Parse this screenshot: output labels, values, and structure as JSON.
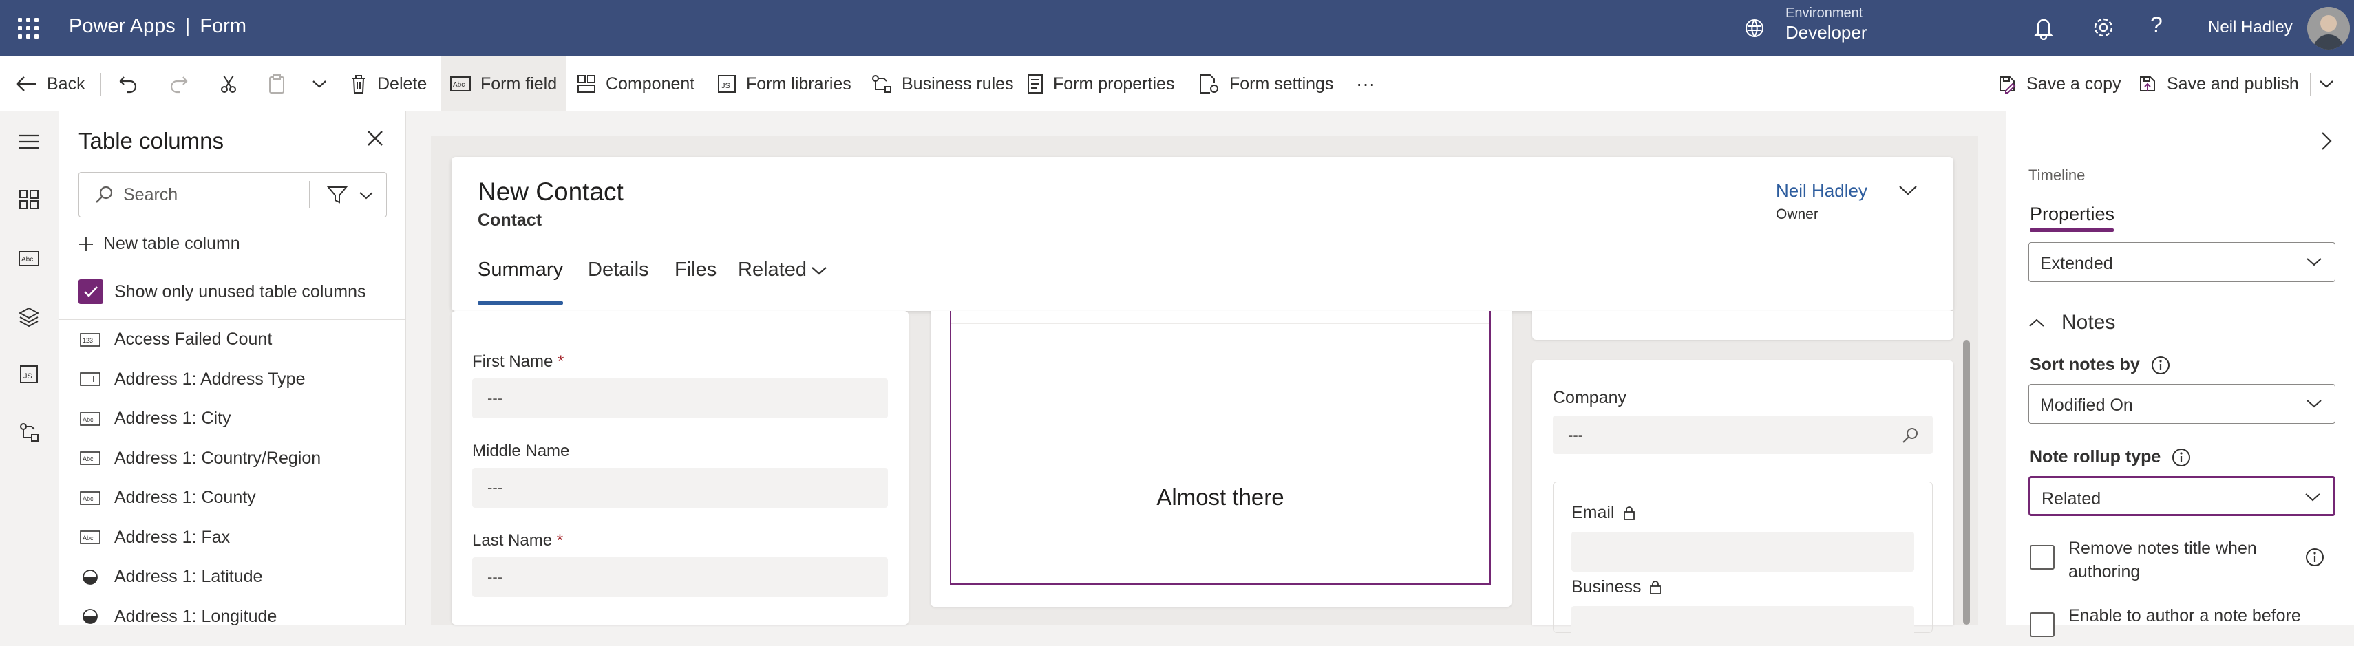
{
  "app": {
    "name": "Power Apps",
    "separator": "|",
    "page": "Form"
  },
  "environment": {
    "label": "Environment",
    "value": "Developer"
  },
  "user": {
    "name": "Neil Hadley"
  },
  "toolbar": {
    "back": "Back",
    "delete": "Delete",
    "form_field": "Form field",
    "component": "Component",
    "form_libraries": "Form libraries",
    "business_rules": "Business rules",
    "form_properties": "Form properties",
    "form_settings": "Form settings",
    "more": "···",
    "save_copy": "Save a copy",
    "save_publish": "Save and publish"
  },
  "left_panel": {
    "title": "Table columns",
    "search_placeholder": "Search",
    "new_column": "New table column",
    "show_unused": "Show only unused table columns",
    "items": [
      {
        "label": "Access Failed Count",
        "icon": "number-icon"
      },
      {
        "label": "Address 1: Address Type",
        "icon": "option-set-icon"
      },
      {
        "label": "Address 1: City",
        "icon": "text-field-icon"
      },
      {
        "label": "Address 1: Country/Region",
        "icon": "text-field-icon"
      },
      {
        "label": "Address 1: County",
        "icon": "text-field-icon"
      },
      {
        "label": "Address 1: Fax",
        "icon": "text-field-icon"
      },
      {
        "label": "Address 1: Latitude",
        "icon": "decimal-icon"
      },
      {
        "label": "Address 1: Longitude",
        "icon": "decimal-icon"
      }
    ]
  },
  "form": {
    "title": "New Contact",
    "subtitle": "Contact",
    "owner_name": "Neil Hadley",
    "owner_label": "Owner",
    "tabs": [
      "Summary",
      "Details",
      "Files",
      "Related"
    ],
    "fields": {
      "first_name": "First Name",
      "middle_name": "Middle Name",
      "last_name": "Last Name",
      "required_mark": "*",
      "empty_value": "---"
    },
    "almost_there": "Almost there",
    "company": "Company",
    "email": "Email",
    "business": "Business"
  },
  "right_panel": {
    "timeline": "Timeline",
    "properties": "Properties",
    "dropdown_top": "Extended",
    "notes_header": "Notes",
    "sort_notes_label": "Sort notes by",
    "sort_notes_value": "Modified On",
    "rollup_label": "Note rollup type",
    "rollup_value": "Related",
    "remove_notes_title_1": "Remove notes title when",
    "remove_notes_title_2": "authoring",
    "enable_author": "Enable to author a note before"
  },
  "colors": {
    "header": "#3b4e7b",
    "accent": "#742774",
    "link": "#2e5d9e"
  }
}
